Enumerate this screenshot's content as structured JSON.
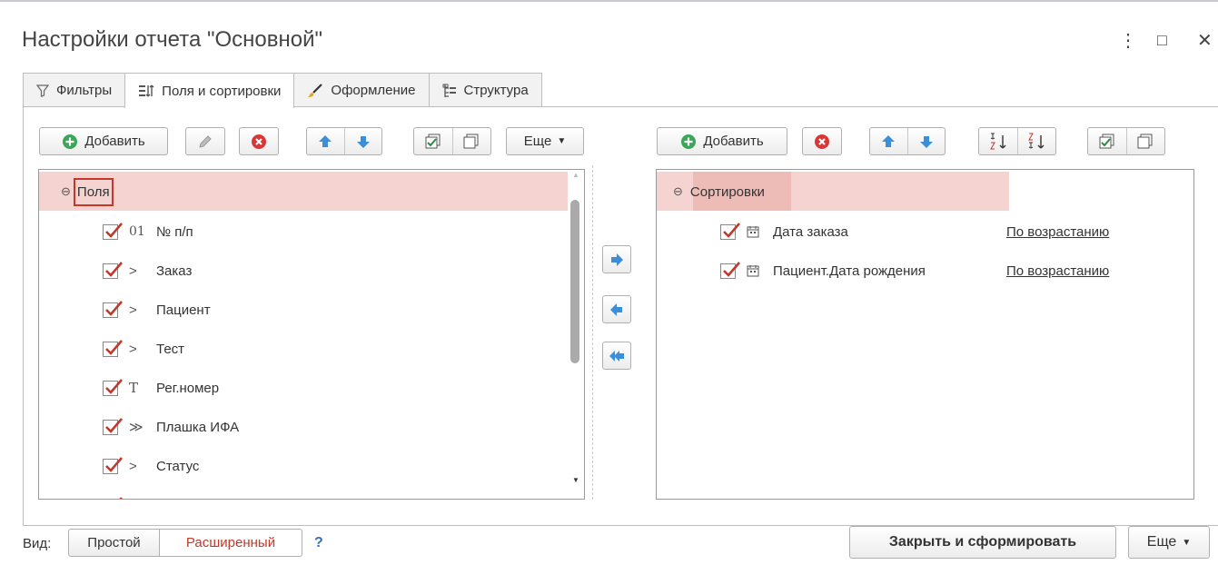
{
  "window": {
    "title": "Настройки отчета \"Основной\"",
    "more_icon": "⋮",
    "maximize_icon": "□",
    "close_icon": "✕"
  },
  "tabs": [
    {
      "label": "Фильтры",
      "icon": "filter-icon"
    },
    {
      "label": "Поля и сортировки",
      "icon": "fields-sort-icon",
      "active": true
    },
    {
      "label": "Оформление",
      "icon": "brush-icon"
    },
    {
      "label": "Структура",
      "icon": "structure-icon"
    }
  ],
  "left_toolbar": {
    "add_label": "Добавить",
    "more_label": "Еще"
  },
  "right_toolbar": {
    "add_label": "Добавить"
  },
  "fields": {
    "group_label": "Поля",
    "items": [
      {
        "type_glyph": "01",
        "label": "№ п/п",
        "checked": true
      },
      {
        "type_glyph": ">",
        "label": "Заказ",
        "checked": true
      },
      {
        "type_glyph": ">",
        "label": "Пациент",
        "checked": true
      },
      {
        "type_glyph": ">",
        "label": "Тест",
        "checked": true
      },
      {
        "type_glyph": "T",
        "label": "Рег.номер",
        "checked": true
      },
      {
        "type_glyph": "≫",
        "label": "Плашка ИФА",
        "checked": true
      },
      {
        "type_glyph": ">",
        "label": "Статус",
        "checked": true
      }
    ]
  },
  "sort": {
    "group_label": "Сортировки",
    "items": [
      {
        "label": "Дата заказа",
        "direction": "По возрастанию",
        "checked": true
      },
      {
        "label": "Пациент.Дата рождения",
        "direction": "По возрастанию",
        "checked": true
      }
    ]
  },
  "footer": {
    "view_label": "Вид:",
    "simple_label": "Простой",
    "extended_label": "Расширенный",
    "help_label": "?",
    "close_build_label": "Закрыть и сформировать",
    "more_label": "Еще"
  },
  "colors": {
    "accent_red": "#c0392b",
    "selection_bg": "#f5d3d0",
    "arrow_blue": "#3b8fd9",
    "add_green": "#3aa657"
  }
}
